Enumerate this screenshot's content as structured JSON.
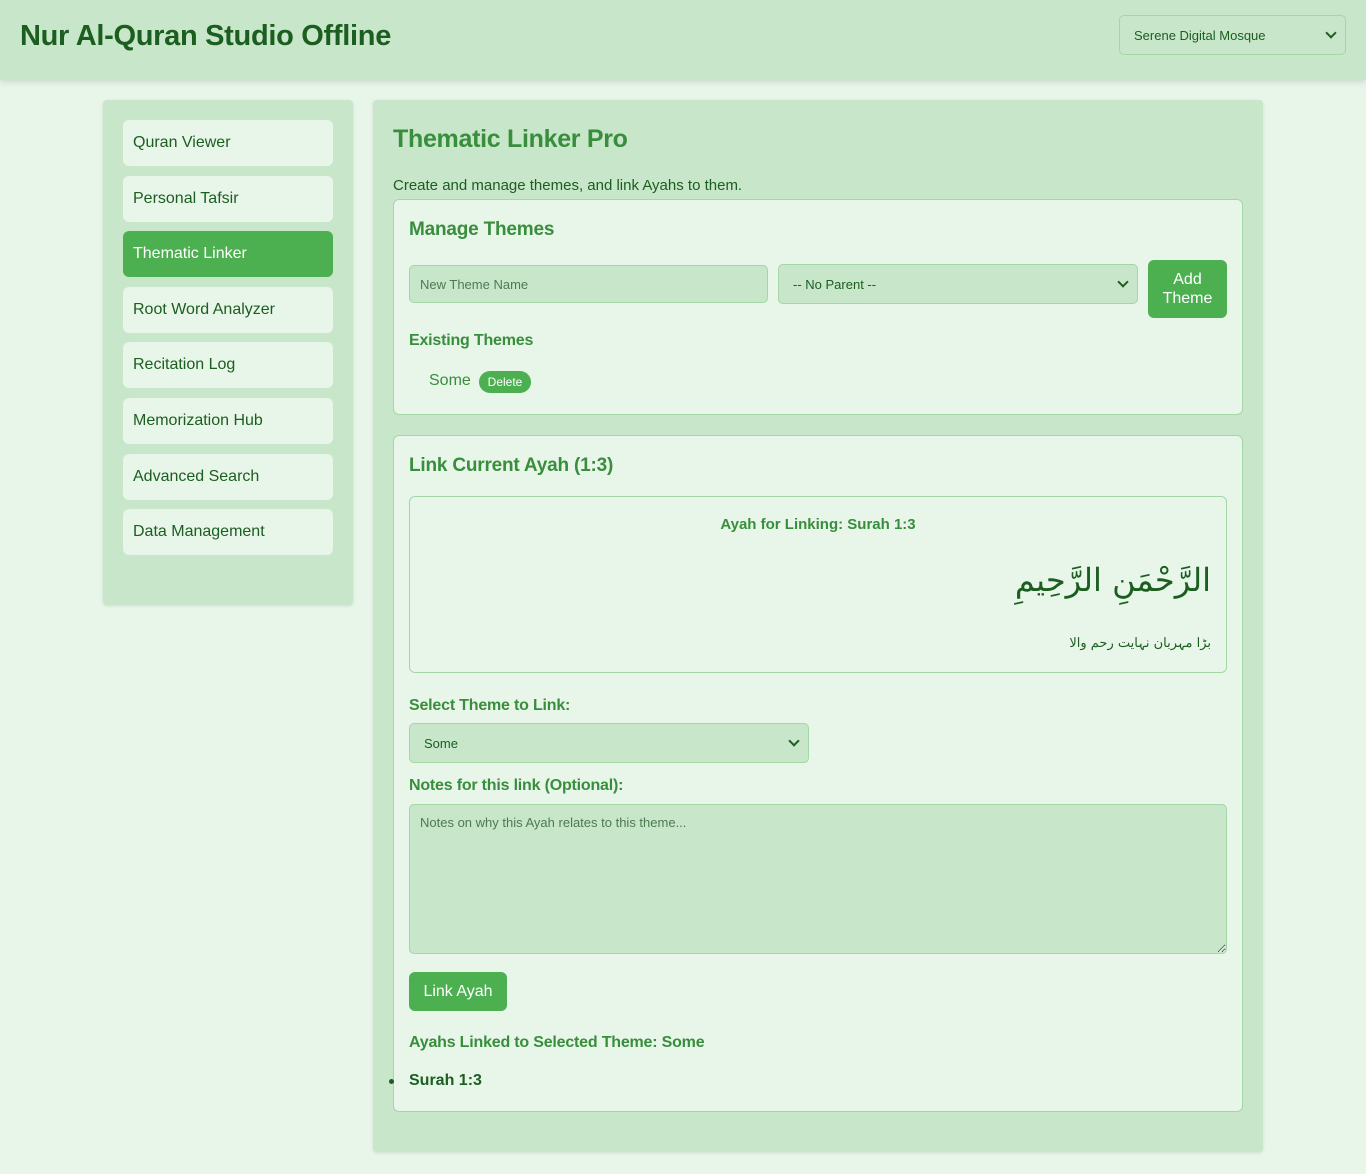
{
  "header": {
    "title": "Nur Al-Quran Studio Offline",
    "theme_select": {
      "selected": "Serene Digital Mosque"
    }
  },
  "sidebar": {
    "items": [
      {
        "label": "Quran Viewer",
        "active": false
      },
      {
        "label": "Personal Tafsir",
        "active": false
      },
      {
        "label": "Thematic Linker",
        "active": true
      },
      {
        "label": "Root Word Analyzer",
        "active": false
      },
      {
        "label": "Recitation Log",
        "active": false
      },
      {
        "label": "Memorization Hub",
        "active": false
      },
      {
        "label": "Advanced Search",
        "active": false
      },
      {
        "label": "Data Management",
        "active": false
      }
    ]
  },
  "main": {
    "title": "Thematic Linker Pro",
    "description": "Create and manage themes, and link Ayahs to them.",
    "manage_themes": {
      "title": "Manage Themes",
      "theme_name_placeholder": "New Theme Name",
      "parent_select": {
        "selected": "-- No Parent --"
      },
      "add_button_line1": "Add",
      "add_button_line2": "Theme",
      "existing_title": "Existing Themes",
      "themes": [
        {
          "name": "Some",
          "delete_label": "Delete"
        }
      ]
    },
    "link_ayah": {
      "title": "Link Current Ayah (1:3)",
      "ayah_heading": "Ayah for Linking: Surah 1:3",
      "arabic_text": "الرَّحْمَنِ الرَّحِيمِ",
      "translation_text": "بڑا مہربان نہایت رحم والا",
      "select_theme_label": "Select Theme to Link:",
      "theme_select": {
        "selected": "Some"
      },
      "notes_label": "Notes for this link (Optional):",
      "notes_placeholder": "Notes on why this Ayah relates to this theme...",
      "link_button": "Link Ayah",
      "linked_heading": "Ayahs Linked to Selected Theme: Some",
      "linked_items": [
        "Surah 1:3"
      ]
    }
  },
  "colors": {
    "background": "#e8f5e9",
    "panel": "#c8e6c9",
    "accent": "#4caf50",
    "heading": "#388e3c",
    "text": "#1b5e20"
  },
  "icons": {
    "select_chevron": "chevron-down-icon",
    "list_bullet": "bullet-icon"
  }
}
